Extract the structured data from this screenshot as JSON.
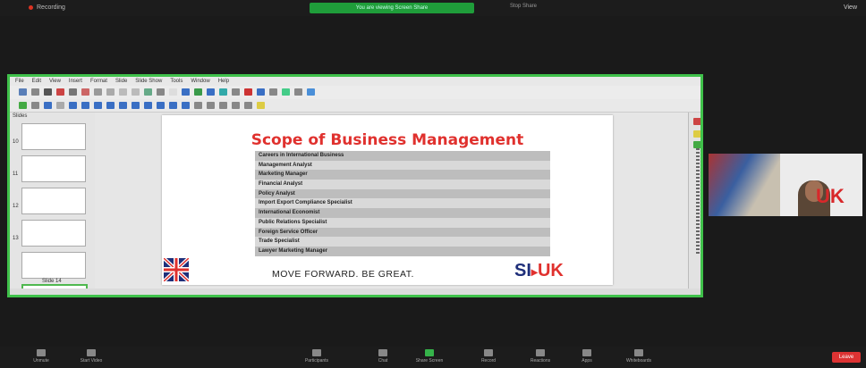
{
  "top_bar": {
    "recording_label": "Recording",
    "share_banner": "You are viewing Screen Share",
    "stop_label": "Stop Share",
    "view_label": "View"
  },
  "menubar": [
    "File",
    "Edit",
    "View",
    "Insert",
    "Format",
    "Slide",
    "Slide Show",
    "Tools",
    "Window",
    "Help"
  ],
  "slides_panel": {
    "title": "Slides",
    "visible_numbers": [
      "10",
      "11",
      "12",
      "13"
    ],
    "current_slide_label": "Slide 14"
  },
  "slide": {
    "title": "Scope of Business Management",
    "items": [
      "Careers in International Business",
      "Management Analyst",
      "Marketing Manager",
      "Financial Analyst",
      "Policy Analyst",
      "Import Export Compliance Specialist",
      "International Economist",
      "Public Relations Specialist",
      "Foreign Service Officer",
      "Trade Specialist",
      "Lawyer Marketing Manager"
    ],
    "tagline": "MOVE FORWARD. BE GREAT.",
    "logo_left": "SI",
    "logo_right": "UK",
    "logo_color_left": "#1f2f7a",
    "logo_color_right": "#e0312e"
  },
  "video_tile": {
    "banner_text": "UK"
  },
  "bottom_bar": {
    "items": [
      "Unmute",
      "Start Video",
      "Participants",
      "Chat",
      "Share Screen",
      "Record",
      "Reactions",
      "Apps",
      "Whiteboards"
    ],
    "leave_label": "Leave"
  },
  "colors": {
    "share_border": "#3fc14a",
    "title_red": "#e0312e"
  }
}
